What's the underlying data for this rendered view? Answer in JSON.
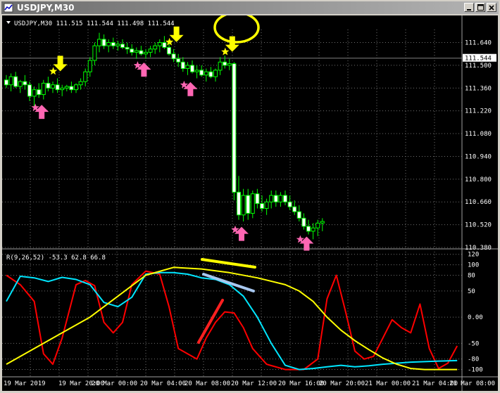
{
  "window": {
    "title": "USDJPY,M30"
  },
  "main": {
    "header": "USDJPY,M30  111.515 111.544 111.498 111.544",
    "price_ticks": [
      "111.640",
      "111.500",
      "111.360",
      "111.220",
      "111.080",
      "110.940",
      "110.800",
      "110.660",
      "110.520",
      "110.380"
    ],
    "current_price": "111.544"
  },
  "indicator": {
    "header": "R(9,26,52) -53.3 62.8 66.8",
    "ticks": [
      "120",
      "100",
      "80",
      "50",
      "0.00",
      "-50",
      "-80",
      "-100"
    ]
  },
  "time_labels": [
    "19 Mar 2019",
    "19 Mar 20:00",
    "20 Mar 00:00",
    "20 Mar 04:00",
    "20 Mar 08:00",
    "20 Mar 12:00",
    "20 Mar 16:00",
    "20 Mar 20:00",
    "21 Mar 00:00",
    "21 Mar 04:00",
    "21 Mar 08:00"
  ],
  "chart_data": [
    {
      "type": "candlestick",
      "title": "USDJPY,M30",
      "ylim": [
        110.38,
        111.72
      ],
      "values": [
        [
          111.41,
          111.44,
          111.36,
          111.38
        ],
        [
          111.38,
          111.45,
          111.34,
          111.43
        ],
        [
          111.43,
          111.46,
          111.36,
          111.37
        ],
        [
          111.37,
          111.41,
          111.33,
          111.4
        ],
        [
          111.4,
          111.44,
          111.35,
          111.38
        ],
        [
          111.38,
          111.4,
          111.28,
          111.31
        ],
        [
          111.31,
          111.37,
          111.24,
          111.35
        ],
        [
          111.35,
          111.39,
          111.3,
          111.32
        ],
        [
          111.32,
          111.41,
          111.29,
          111.39
        ],
        [
          111.39,
          111.43,
          111.34,
          111.36
        ],
        [
          111.36,
          111.4,
          111.33,
          111.38
        ],
        [
          111.38,
          111.42,
          111.33,
          111.35
        ],
        [
          111.35,
          111.38,
          111.31,
          111.36
        ],
        [
          111.36,
          111.38,
          111.34,
          111.37
        ],
        [
          111.37,
          111.4,
          111.33,
          111.35
        ],
        [
          111.35,
          111.39,
          111.33,
          111.38
        ],
        [
          111.38,
          111.42,
          111.35,
          111.4
        ],
        [
          111.4,
          111.48,
          111.37,
          111.46
        ],
        [
          111.46,
          111.55,
          111.43,
          111.53
        ],
        [
          111.53,
          111.64,
          111.5,
          111.62
        ],
        [
          111.62,
          111.7,
          111.58,
          111.66
        ],
        [
          111.66,
          111.69,
          111.6,
          111.62
        ],
        [
          111.62,
          111.66,
          111.58,
          111.64
        ],
        [
          111.64,
          111.67,
          111.6,
          111.62
        ],
        [
          111.62,
          111.65,
          111.59,
          111.63
        ],
        [
          111.63,
          111.66,
          111.6,
          111.61
        ],
        [
          111.61,
          111.64,
          111.57,
          111.6
        ],
        [
          111.6,
          111.63,
          111.56,
          111.58
        ],
        [
          111.58,
          111.61,
          111.54,
          111.59
        ],
        [
          111.59,
          111.62,
          111.56,
          111.57
        ],
        [
          111.57,
          111.6,
          111.54,
          111.58
        ],
        [
          111.58,
          111.62,
          111.55,
          111.6
        ],
        [
          111.6,
          111.64,
          111.57,
          111.62
        ],
        [
          111.62,
          111.66,
          111.58,
          111.64
        ],
        [
          111.64,
          111.68,
          111.6,
          111.61
        ],
        [
          111.61,
          111.64,
          111.56,
          111.57
        ],
        [
          111.57,
          111.6,
          111.52,
          111.54
        ],
        [
          111.54,
          111.57,
          111.49,
          111.52
        ],
        [
          111.52,
          111.55,
          111.46,
          111.48
        ],
        [
          111.48,
          111.52,
          111.44,
          111.5
        ],
        [
          111.5,
          111.53,
          111.45,
          111.46
        ],
        [
          111.46,
          111.5,
          111.42,
          111.47
        ],
        [
          111.47,
          111.5,
          111.43,
          111.44
        ],
        [
          111.44,
          111.48,
          111.4,
          111.46
        ],
        [
          111.46,
          111.49,
          111.42,
          111.43
        ],
        [
          111.43,
          111.48,
          111.4,
          111.47
        ],
        [
          111.47,
          111.55,
          111.44,
          111.52
        ],
        [
          111.52,
          111.56,
          111.48,
          111.5
        ],
        [
          111.5,
          111.54,
          111.47,
          111.51
        ],
        [
          111.51,
          111.52,
          110.67,
          110.72
        ],
        [
          110.72,
          110.82,
          110.55,
          110.58
        ],
        [
          110.58,
          110.74,
          110.54,
          110.7
        ],
        [
          110.7,
          110.74,
          110.55,
          110.59
        ],
        [
          110.59,
          110.73,
          110.56,
          110.71
        ],
        [
          110.71,
          110.74,
          110.62,
          110.65
        ],
        [
          110.65,
          110.7,
          110.6,
          110.62
        ],
        [
          110.62,
          110.68,
          110.58,
          110.66
        ],
        [
          110.66,
          110.73,
          110.62,
          110.7
        ],
        [
          110.7,
          110.73,
          110.63,
          110.66
        ],
        [
          110.66,
          110.72,
          110.63,
          110.7
        ],
        [
          110.7,
          110.73,
          110.64,
          110.66
        ],
        [
          110.66,
          110.7,
          110.61,
          110.63
        ],
        [
          110.63,
          110.67,
          110.58,
          110.6
        ],
        [
          110.6,
          110.64,
          110.54,
          110.56
        ],
        [
          110.56,
          110.59,
          110.49,
          110.51
        ],
        [
          110.51,
          110.55,
          110.46,
          110.48
        ],
        [
          110.48,
          110.53,
          110.43,
          110.5
        ],
        [
          110.5,
          110.55,
          110.45,
          110.53
        ],
        [
          110.53,
          110.56,
          110.48,
          110.54
        ]
      ],
      "markers": [
        {
          "i": 7,
          "type": "buy"
        },
        {
          "i": 11,
          "type": "sell"
        },
        {
          "i": 29,
          "type": "buy"
        },
        {
          "i": 36,
          "type": "sell"
        },
        {
          "i": 39,
          "type": "buy"
        },
        {
          "i": 48,
          "type": "sell"
        },
        {
          "i": 50,
          "type": "buy"
        },
        {
          "i": 64,
          "type": "buy"
        }
      ]
    },
    {
      "type": "line",
      "title": "R(9,26,52) -53.3 62.8 66.8",
      "ylim": [
        -110,
        125
      ],
      "series": [
        {
          "color": "#ff0000",
          "values": [
            [
              0,
              80
            ],
            [
              3,
              62
            ],
            [
              6,
              30
            ],
            [
              8,
              -70
            ],
            [
              10,
              -90
            ],
            [
              12,
              -40
            ],
            [
              15,
              62
            ],
            [
              17,
              70
            ],
            [
              19,
              60
            ],
            [
              21,
              -10
            ],
            [
              23,
              -30
            ],
            [
              25,
              -10
            ],
            [
              27,
              62
            ],
            [
              30,
              88
            ],
            [
              33,
              82
            ],
            [
              35,
              20
            ],
            [
              37,
              -60
            ],
            [
              39,
              -70
            ],
            [
              41,
              -80
            ],
            [
              43,
              -40
            ],
            [
              45,
              -10
            ],
            [
              47,
              10
            ],
            [
              49,
              8
            ],
            [
              51,
              -20
            ],
            [
              53,
              -60
            ],
            [
              56,
              -90
            ],
            [
              60,
              -100
            ],
            [
              64,
              -100
            ],
            [
              67,
              -80
            ],
            [
              69,
              35
            ],
            [
              71,
              80
            ],
            [
              73,
              10
            ],
            [
              75,
              -65
            ],
            [
              77,
              -80
            ],
            [
              79,
              -75
            ],
            [
              81,
              -40
            ],
            [
              83,
              -5
            ],
            [
              85,
              -20
            ],
            [
              87,
              -30
            ],
            [
              89,
              25
            ],
            [
              91,
              -60
            ],
            [
              93,
              -98
            ],
            [
              95,
              -88
            ],
            [
              97,
              -55
            ]
          ]
        },
        {
          "color": "#00e6ff",
          "values": [
            [
              0,
              30
            ],
            [
              3,
              78
            ],
            [
              6,
              75
            ],
            [
              9,
              68
            ],
            [
              12,
              76
            ],
            [
              15,
              72
            ],
            [
              18,
              62
            ],
            [
              21,
              28
            ],
            [
              24,
              20
            ],
            [
              27,
              38
            ],
            [
              30,
              82
            ],
            [
              33,
              85
            ],
            [
              36,
              85
            ],
            [
              39,
              82
            ],
            [
              42,
              75
            ],
            [
              45,
              72
            ],
            [
              48,
              62
            ],
            [
              51,
              40
            ],
            [
              54,
              0
            ],
            [
              57,
              -50
            ],
            [
              60,
              -92
            ],
            [
              63,
              -100
            ],
            [
              66,
              -98
            ],
            [
              69,
              -95
            ],
            [
              72,
              -92
            ],
            [
              75,
              -95
            ],
            [
              78,
              -93
            ],
            [
              81,
              -90
            ],
            [
              84,
              -88
            ],
            [
              87,
              -86
            ],
            [
              90,
              -85
            ],
            [
              93,
              -84
            ],
            [
              97,
              -83
            ]
          ]
        },
        {
          "color": "#ffff00",
          "values": [
            [
              0,
              -90
            ],
            [
              6,
              -60
            ],
            [
              12,
              -30
            ],
            [
              18,
              0
            ],
            [
              24,
              40
            ],
            [
              30,
              80
            ],
            [
              36,
              95
            ],
            [
              42,
              92
            ],
            [
              48,
              85
            ],
            [
              54,
              75
            ],
            [
              60,
              62
            ],
            [
              63,
              50
            ],
            [
              66,
              30
            ],
            [
              69,
              0
            ],
            [
              72,
              -25
            ],
            [
              75,
              -45
            ],
            [
              78,
              -62
            ],
            [
              81,
              -78
            ],
            [
              84,
              -90
            ],
            [
              87,
              -98
            ],
            [
              90,
              -100
            ],
            [
              97,
              -100
            ]
          ]
        }
      ]
    }
  ]
}
